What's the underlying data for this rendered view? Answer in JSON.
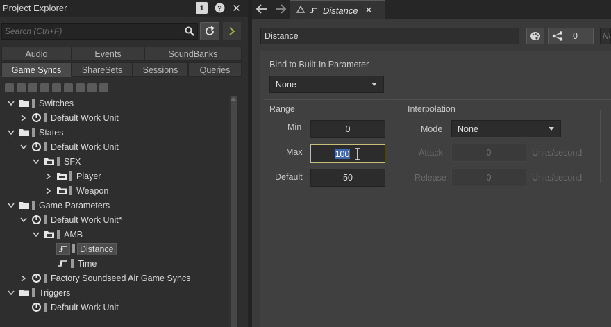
{
  "left": {
    "title": "Project Explorer",
    "badge": "1",
    "help": "?",
    "close": "✕",
    "search": {
      "placeholder": "Search (Ctrl+F)"
    },
    "tabs_row1": [
      "Audio",
      "Events",
      "SoundBanks"
    ],
    "tabs_row2": [
      "Game Syncs",
      "ShareSets",
      "Sessions",
      "Queries"
    ],
    "active_tab": "Game Syncs",
    "tree": [
      {
        "label": "Switches",
        "icon": "folder-icon",
        "expanded": true
      },
      {
        "label": "Default Work Unit",
        "icon": "work-unit-icon",
        "expanded": false
      },
      {
        "label": "States",
        "icon": "folder-icon",
        "expanded": true
      },
      {
        "label": "Default Work Unit",
        "icon": "work-unit-icon",
        "expanded": true
      },
      {
        "label": "SFX",
        "icon": "folder-icon",
        "expanded": true
      },
      {
        "label": "Player",
        "icon": "folder-icon",
        "expanded": false
      },
      {
        "label": "Weapon",
        "icon": "folder-icon",
        "expanded": false
      },
      {
        "label": "Game Parameters",
        "icon": "folder-icon",
        "expanded": true
      },
      {
        "label": "Default Work Unit*",
        "icon": "work-unit-icon",
        "expanded": true
      },
      {
        "label": "AMB",
        "icon": "folder-icon",
        "expanded": true
      },
      {
        "label": "Distance",
        "icon": "game-parameter-icon",
        "selected": true
      },
      {
        "label": "Time",
        "icon": "game-parameter-icon"
      },
      {
        "label": "Factory Soundseed Air Game Syncs",
        "icon": "work-unit-icon",
        "expanded": false
      },
      {
        "label": "Triggers",
        "icon": "folder-icon",
        "expanded": true
      },
      {
        "label": "Default Work Unit",
        "icon": "work-unit-icon"
      }
    ]
  },
  "right": {
    "tab_label": "Distance",
    "tab_close": "✕",
    "name": "Distance",
    "share_count": "0",
    "notes_placeholder": "Notes",
    "bind_label": "Bind to Built-In Parameter",
    "bind_value": "None",
    "range_label": "Range",
    "min_label": "Min",
    "min_value": "0",
    "max_label": "Max",
    "max_value": "100",
    "default_label": "Default",
    "default_value": "50",
    "interp_label": "Interpolation",
    "mode_label": "Mode",
    "mode_value": "None",
    "attack_label": "Attack",
    "attack_value": "0",
    "attack_unit": "Units/second",
    "release_label": "Release",
    "release_value": "0",
    "release_unit": "Units/second"
  }
}
